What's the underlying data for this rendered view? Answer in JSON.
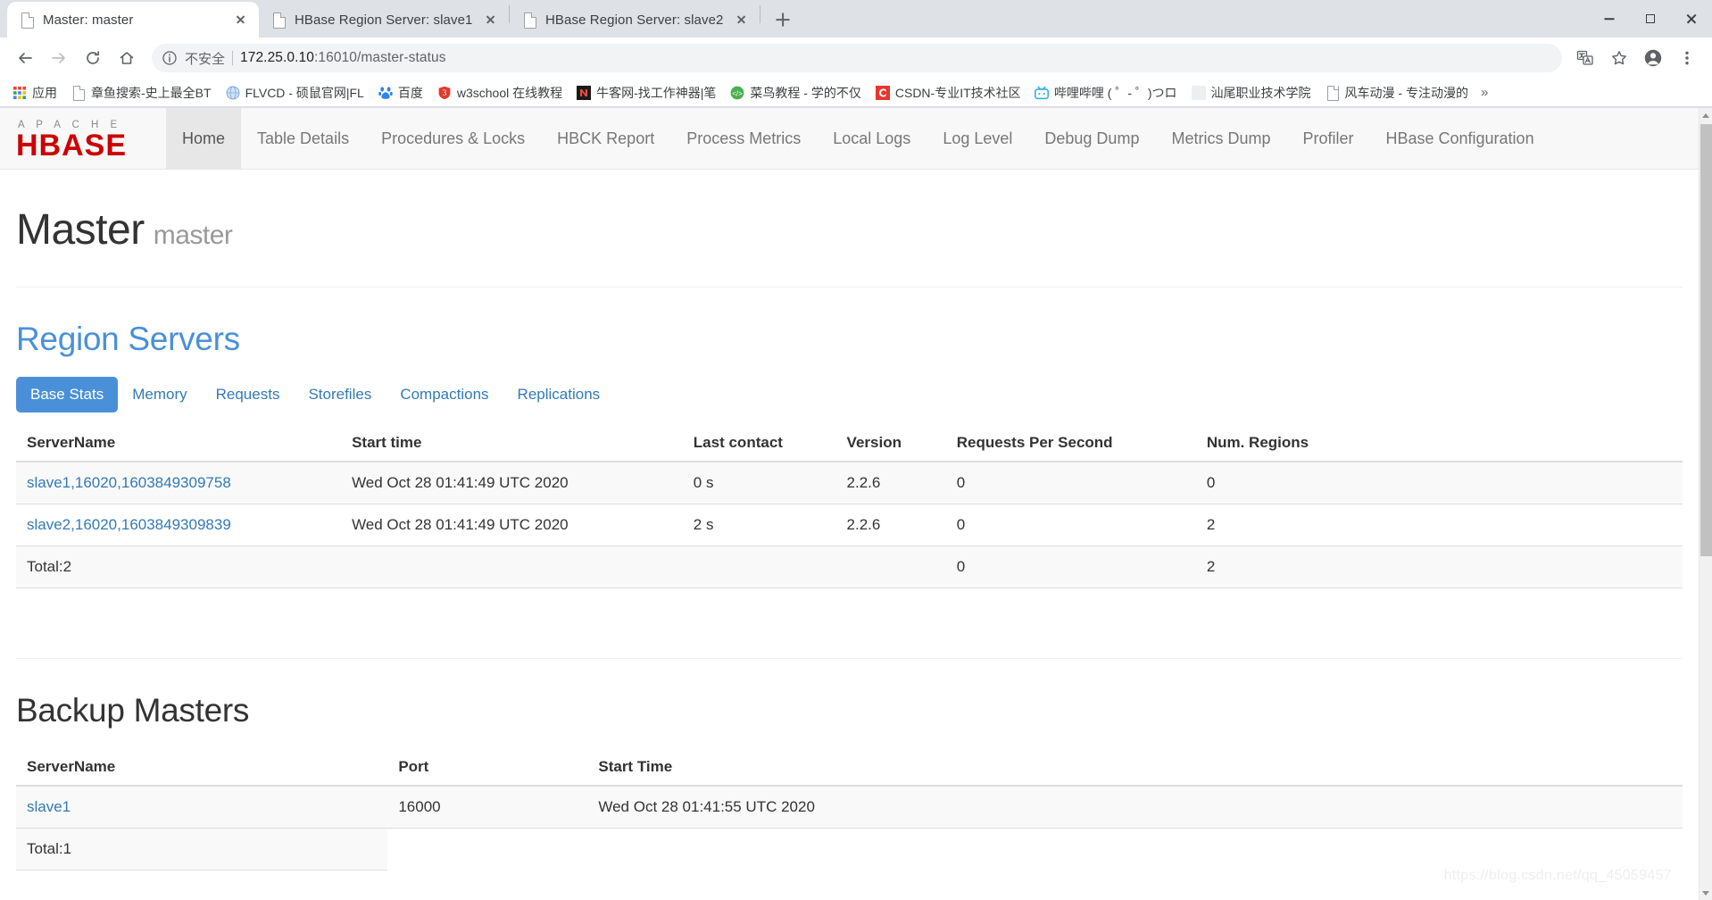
{
  "browser": {
    "tabs": [
      {
        "title": "Master: master",
        "active": true,
        "favicon": "page-icon",
        "close_label": "×"
      },
      {
        "title": "HBase Region Server: slave1",
        "active": false,
        "favicon": "page-icon",
        "close_label": "×"
      },
      {
        "title": "HBase Region Server: slave2",
        "active": false,
        "favicon": "page-icon",
        "close_label": "×"
      }
    ],
    "new_tab_label": "+",
    "window_controls": {
      "minimize": "–",
      "maximize": "□",
      "close": "×"
    },
    "toolbar": {
      "back": "back-arrow",
      "forward": "forward-arrow",
      "reload": "reload",
      "home": "home",
      "security_text": "不安全",
      "url_host": "172.25.0.10",
      "url_path": ":16010/master-status",
      "translate": "translate-icon",
      "bookmark_star": "star-icon",
      "profile": "profile-icon",
      "menu": "three-dot-menu-icon"
    },
    "bookmarks": [
      {
        "label": "应用",
        "icon": "apps-grid-icon"
      },
      {
        "label": "章鱼搜索-史上最全BT",
        "icon": "page-icon"
      },
      {
        "label": "FLVCD - 硕鼠官网|FL",
        "icon": "globe-blue-icon"
      },
      {
        "label": "百度",
        "icon": "baidu-icon"
      },
      {
        "label": "w3school 在线教程",
        "icon": "w3school-icon"
      },
      {
        "label": "牛客网-找工作神器|笔",
        "icon": "nowcoder-icon"
      },
      {
        "label": "菜鸟教程 - 学的不仅",
        "icon": "runoob-icon"
      },
      {
        "label": "CSDN-专业IT技术社区",
        "icon": "csdn-icon"
      },
      {
        "label": "哔哩哔哩 ( ゜- ゜)つロ",
        "icon": "bilibili-icon"
      },
      {
        "label": "汕尾职业技术学院",
        "icon": "blank-icon"
      },
      {
        "label": "风车动漫 - 专注动漫的",
        "icon": "page-icon"
      }
    ],
    "bookmarks_overflow": "»"
  },
  "page": {
    "brand": {
      "top": "A P A C H E",
      "bottom": "HBASE"
    },
    "nav": [
      {
        "label": "Home",
        "active": true
      },
      {
        "label": "Table Details",
        "active": false
      },
      {
        "label": "Procedures & Locks",
        "active": false
      },
      {
        "label": "HBCK Report",
        "active": false
      },
      {
        "label": "Process Metrics",
        "active": false
      },
      {
        "label": "Local Logs",
        "active": false
      },
      {
        "label": "Log Level",
        "active": false
      },
      {
        "label": "Debug Dump",
        "active": false
      },
      {
        "label": "Metrics Dump",
        "active": false
      },
      {
        "label": "Profiler",
        "active": false
      },
      {
        "label": "HBase Configuration",
        "active": false
      }
    ],
    "title": "Master",
    "subtitle": "master",
    "region_servers": {
      "heading": "Region Servers",
      "tabs": [
        {
          "label": "Base Stats",
          "active": true
        },
        {
          "label": "Memory",
          "active": false
        },
        {
          "label": "Requests",
          "active": false
        },
        {
          "label": "Storefiles",
          "active": false
        },
        {
          "label": "Compactions",
          "active": false
        },
        {
          "label": "Replications",
          "active": false
        }
      ],
      "columns": [
        "ServerName",
        "Start time",
        "Last contact",
        "Version",
        "Requests Per Second",
        "Num. Regions"
      ],
      "rows": [
        {
          "server_name": "slave1,16020,1603849309758",
          "start_time": "Wed Oct 28 01:41:49 UTC 2020",
          "last_contact": "0 s",
          "version": "2.2.6",
          "requests_per_second": "0",
          "num_regions": "0"
        },
        {
          "server_name": "slave2,16020,1603849309839",
          "start_time": "Wed Oct 28 01:41:49 UTC 2020",
          "last_contact": "2 s",
          "version": "2.2.6",
          "requests_per_second": "0",
          "num_regions": "2"
        }
      ],
      "total": {
        "label": "Total:2",
        "start_time": "",
        "last_contact": "",
        "version": "",
        "requests_per_second": "0",
        "num_regions": "2"
      }
    },
    "backup_masters": {
      "heading": "Backup Masters",
      "columns": [
        "ServerName",
        "Port",
        "Start Time"
      ],
      "rows": [
        {
          "server_name": "slave1",
          "port": "16000",
          "start_time": "Wed Oct 28 01:41:55 UTC 2020"
        }
      ],
      "total": {
        "label": "Total:1",
        "port": "",
        "start_time": ""
      }
    },
    "watermark": "https://blog.csdn.net/qq_45059457"
  },
  "colors": {
    "brand_red": "#cc0000",
    "link_blue": "#337ab7",
    "tab_active_blue": "#4a90d9",
    "heading_blue": "#4a90d9",
    "nav_bg": "#f8f8f8"
  }
}
